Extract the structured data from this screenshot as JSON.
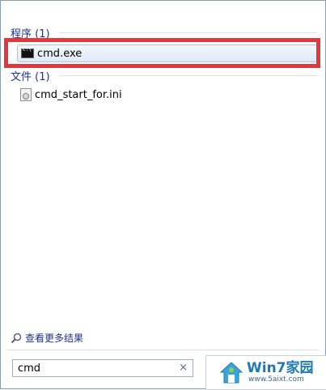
{
  "groups": [
    {
      "header": "程序 (1)",
      "items": [
        {
          "label": "cmd.exe",
          "icon": "cmd-icon"
        }
      ]
    },
    {
      "header": "文件 (1)",
      "items": [
        {
          "label": "cmd_start_for.ini",
          "icon": "ini-file-icon"
        }
      ]
    }
  ],
  "see_more_label": "查看更多结果",
  "search": {
    "value": "cmd",
    "clear_glyph": "×"
  },
  "watermark": {
    "title": "Win7家园",
    "url": "www.5aixt.com"
  },
  "colors": {
    "highlight_frame": "#e0383d",
    "header_text": "#1e3287",
    "watermark_blue": "#1d79b4"
  }
}
